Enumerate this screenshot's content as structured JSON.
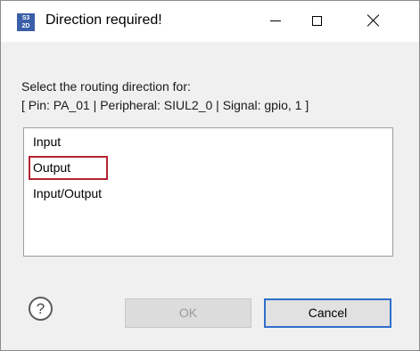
{
  "window": {
    "title": "Direction required!",
    "app_icon_text": "S32DS"
  },
  "prompt": {
    "line1": "Select the routing direction for:",
    "line2": "[ Pin: PA_01 | Peripheral: SIUL2_0 | Signal: gpio, 1 ]"
  },
  "list": {
    "items": [
      "Input",
      "Output",
      "Input/Output"
    ],
    "highlighted": "Output"
  },
  "buttons": {
    "help_glyph": "?",
    "ok_label": "OK",
    "cancel_label": "Cancel"
  },
  "colors": {
    "highlight_border": "#b52331",
    "cancel_focus_border": "#2f6fca"
  }
}
